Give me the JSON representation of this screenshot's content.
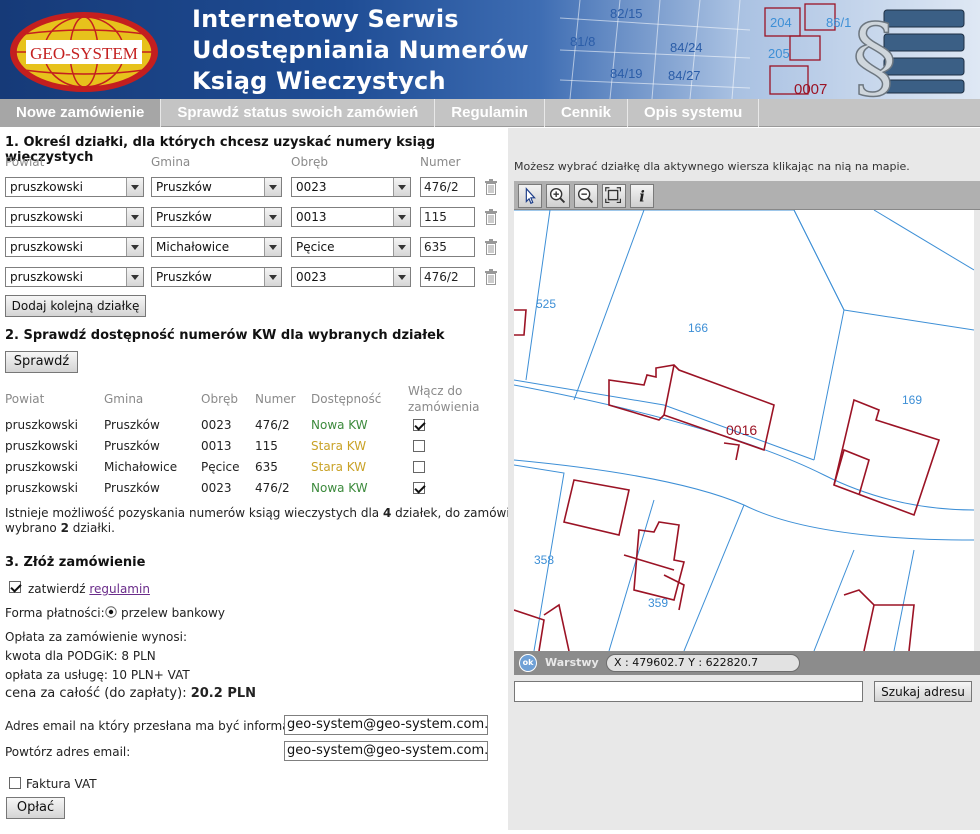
{
  "header": {
    "logo_text": "GEO-SYSTEM",
    "title": "Internetowy Serwis\nUdostępniania Numerów\nKsiąg Wieczystych",
    "map_labels": [
      "204",
      "86/1",
      "205",
      "84/24",
      "84/27",
      "84/19",
      "0007",
      "82/15",
      "81/8"
    ]
  },
  "nav": {
    "items": [
      {
        "label": "Nowe zamówienie"
      },
      {
        "label": "Sprawdź status swoich zamówień"
      },
      {
        "label": "Regulamin"
      },
      {
        "label": "Cennik"
      },
      {
        "label": "Opis systemu"
      }
    ]
  },
  "step1": {
    "title": "1. Określ działki, dla których chcesz uzyskać numery ksiąg wieczystych",
    "headers": {
      "powiat": "Powiat",
      "gmina": "Gmina",
      "obreb": "Obręb",
      "numer": "Numer"
    },
    "rows": [
      {
        "powiat": "pruszkowski",
        "gmina": "Pruszków",
        "obreb": "0023",
        "numer": "476/2"
      },
      {
        "powiat": "pruszkowski",
        "gmina": "Pruszków",
        "obreb": "0013",
        "numer": "115"
      },
      {
        "powiat": "pruszkowski",
        "gmina": "Michałowice",
        "obreb": "Pęcice",
        "numer": "635"
      },
      {
        "powiat": "pruszkowski",
        "gmina": "Pruszków",
        "obreb": "0023",
        "numer": "476/2"
      }
    ],
    "add_button": "Dodaj kolejną działkę"
  },
  "step2": {
    "title": "2. Sprawdź dostępność numerów KW dla wybranych działek",
    "check_button": "Sprawdź",
    "headers": {
      "powiat": "Powiat",
      "gmina": "Gmina",
      "obreb": "Obręb",
      "numer": "Numer",
      "dostepnosc": "Dostępność",
      "wlacz_1": "Włącz do",
      "wlacz_2": "zamówienia"
    },
    "rows": [
      {
        "powiat": "pruszkowski",
        "gmina": "Pruszków",
        "obreb": "0023",
        "numer": "476/2",
        "dostepnosc": "Nowa KW",
        "status_color": "#3c8a3c",
        "checked": true
      },
      {
        "powiat": "pruszkowski",
        "gmina": "Pruszków",
        "obreb": "0013",
        "numer": "115",
        "dostepnosc": "Stara KW",
        "status_color": "#c9a227",
        "checked": false
      },
      {
        "powiat": "pruszkowski",
        "gmina": "Michałowice",
        "obreb": "Pęcice",
        "numer": "635",
        "dostepnosc": "Stara KW",
        "status_color": "#c9a227",
        "checked": false
      },
      {
        "powiat": "pruszkowski",
        "gmina": "Pruszków",
        "obreb": "0023",
        "numer": "476/2",
        "dostepnosc": "Nowa KW",
        "status_color": "#3c8a3c",
        "checked": true
      }
    ],
    "summary_1a": "Istnieje możliwość pozyskania numerów ksiąg wieczystych dla ",
    "summary_count_available": "4",
    "summary_1b": " działek, do zamówienia",
    "summary_2a": "wybrano ",
    "summary_count_selected": "2",
    "summary_2b": " działki."
  },
  "step3": {
    "title": "3. Złóż zamówienie",
    "accept_label": "zatwierdź ",
    "regulamin_link": "regulamin",
    "accept_checked": true,
    "payment_label": "Forma płatności:",
    "payment_option": "przelew bankowy",
    "fee_title": "Opłata za zamówienie wynosi:",
    "fee_podgik": "kwota dla PODGiK: 8 PLN",
    "fee_service": "opłata za usługę: 10 PLN+ VAT",
    "total_label": "cena za całość (do zapłaty): ",
    "total_value": "20.2 PLN",
    "email_label": "Adres email na który przesłana ma być informacja:",
    "email_value": "geo-system@geo-system.com.pl",
    "email_repeat_label": "Powtórz adres email:",
    "email_repeat_value": "geo-system@geo-system.com.pl",
    "invoice_label": "Faktura VAT",
    "invoice_checked": false,
    "pay_button": "Opłać"
  },
  "map": {
    "hint": "Możesz wybrać działkę dla aktywnego wiersza klikając na nią na mapie.",
    "tools": [
      "select-arrow-icon",
      "zoom-in-icon",
      "zoom-out-icon",
      "full-extent-icon",
      "info-icon"
    ],
    "parcel_labels": [
      "525",
      "166",
      "169",
      "0016",
      "358",
      "359"
    ],
    "layers_label": "Warstwy",
    "ok_label": "ok",
    "coords": "X : 479602.7  Y : 622820.7",
    "address_placeholder": "",
    "search_button": "Szukaj adresu"
  },
  "colors": {
    "parcel_line": "#9b1325",
    "boundary_line": "#3d8fd6",
    "parcel_label": "#3d8fd6",
    "selected_label": "#9b1325",
    "nav_bg": "#c4c4c4",
    "nav_active": "#a6a6a6",
    "header_dark": "#163a78",
    "logo_red": "#c41f1f",
    "logo_gold": "#e7c21c"
  }
}
